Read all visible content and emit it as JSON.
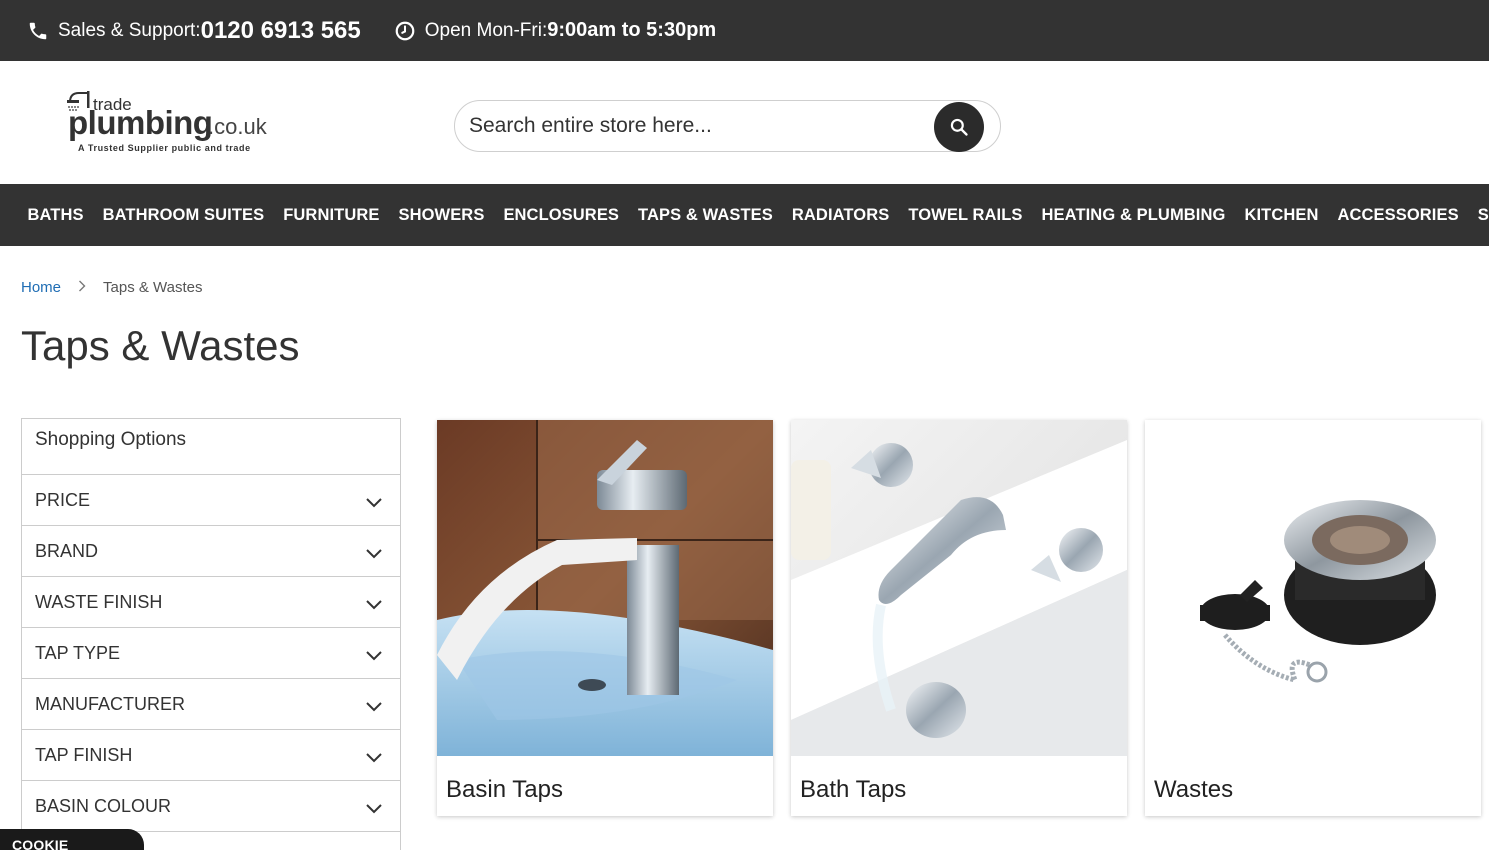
{
  "topbar": {
    "sales_label": "Sales & Support:",
    "sales_phone": "0120 6913 565",
    "hours_label": "Open Mon-Fri:",
    "hours_value": "9:00am to 5:30pm"
  },
  "logo": {
    "line1": "trade",
    "line2": "plumbing",
    "domain": ".co.uk",
    "tagline": "A Trusted Supplier public and trade"
  },
  "search": {
    "placeholder": "Search entire store here..."
  },
  "nav": {
    "items": [
      "BATHS",
      "BATHROOM SUITES",
      "FURNITURE",
      "SHOWERS",
      "ENCLOSURES",
      "TAPS & WASTES",
      "RADIATORS",
      "TOWEL RAILS",
      "HEATING & PLUMBING",
      "KITCHEN",
      "ACCESSORIES",
      "SHOP BY BRAND"
    ]
  },
  "breadcrumb": {
    "home": "Home",
    "current": "Taps & Wastes"
  },
  "page_title": "Taps & Wastes",
  "sidebar": {
    "heading": "Shopping Options",
    "filters": [
      "PRICE",
      "BRAND",
      "WASTE FINISH",
      "TAP TYPE",
      "MANUFACTURER",
      "TAP FINISH",
      "BASIN COLOUR"
    ]
  },
  "categories": [
    {
      "name": "Basin Taps"
    },
    {
      "name": "Bath Taps"
    },
    {
      "name": "Wastes"
    }
  ],
  "cookie": {
    "label": "COOKIE SETTINGS"
  }
}
